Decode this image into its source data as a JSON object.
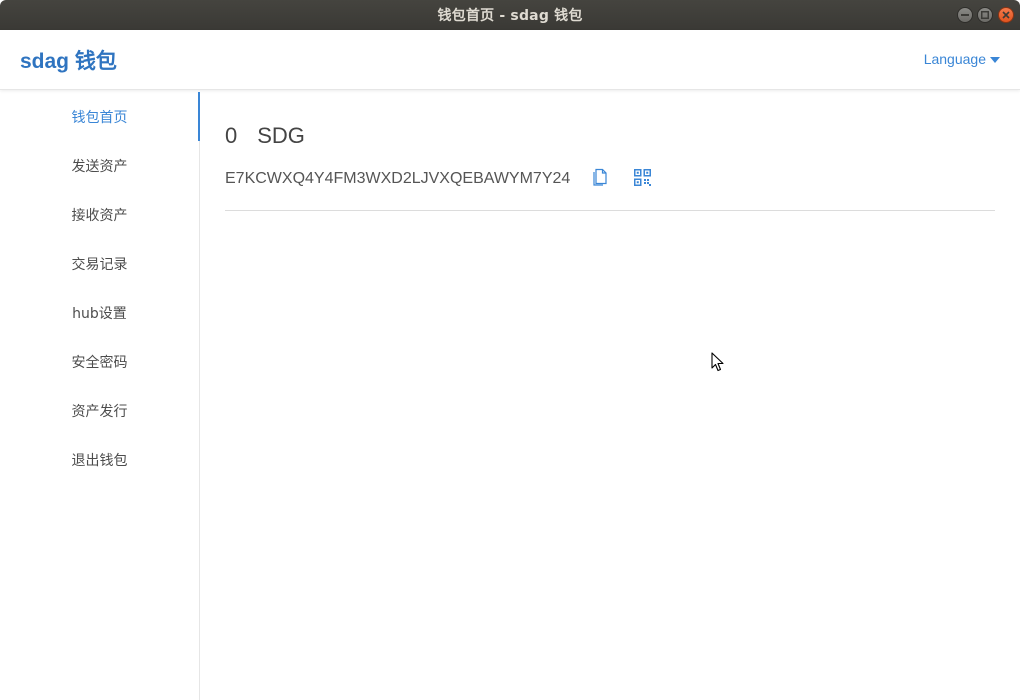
{
  "window": {
    "title": "钱包首页 - sdag 钱包"
  },
  "header": {
    "brand": "sdag 钱包",
    "language_label": "Language"
  },
  "sidebar": {
    "items": [
      {
        "label": "钱包首页",
        "active": true
      },
      {
        "label": "发送资产"
      },
      {
        "label": "接收资产"
      },
      {
        "label": "交易记录"
      },
      {
        "label": "hub设置"
      },
      {
        "label": "安全密码"
      },
      {
        "label": "资产发行"
      },
      {
        "label": "退出钱包"
      }
    ]
  },
  "main": {
    "balance_amount": "0",
    "balance_unit": "SDG",
    "address": "E7KCWXQ4Y4FM3WXD2LJVXQEBAWYM7Y24",
    "icons": {
      "copy": "copy-icon",
      "qr": "qr-code-icon"
    }
  },
  "colors": {
    "accent": "#3a86d6",
    "brand": "#2f74c0",
    "titlebar": "#3c3b37"
  }
}
